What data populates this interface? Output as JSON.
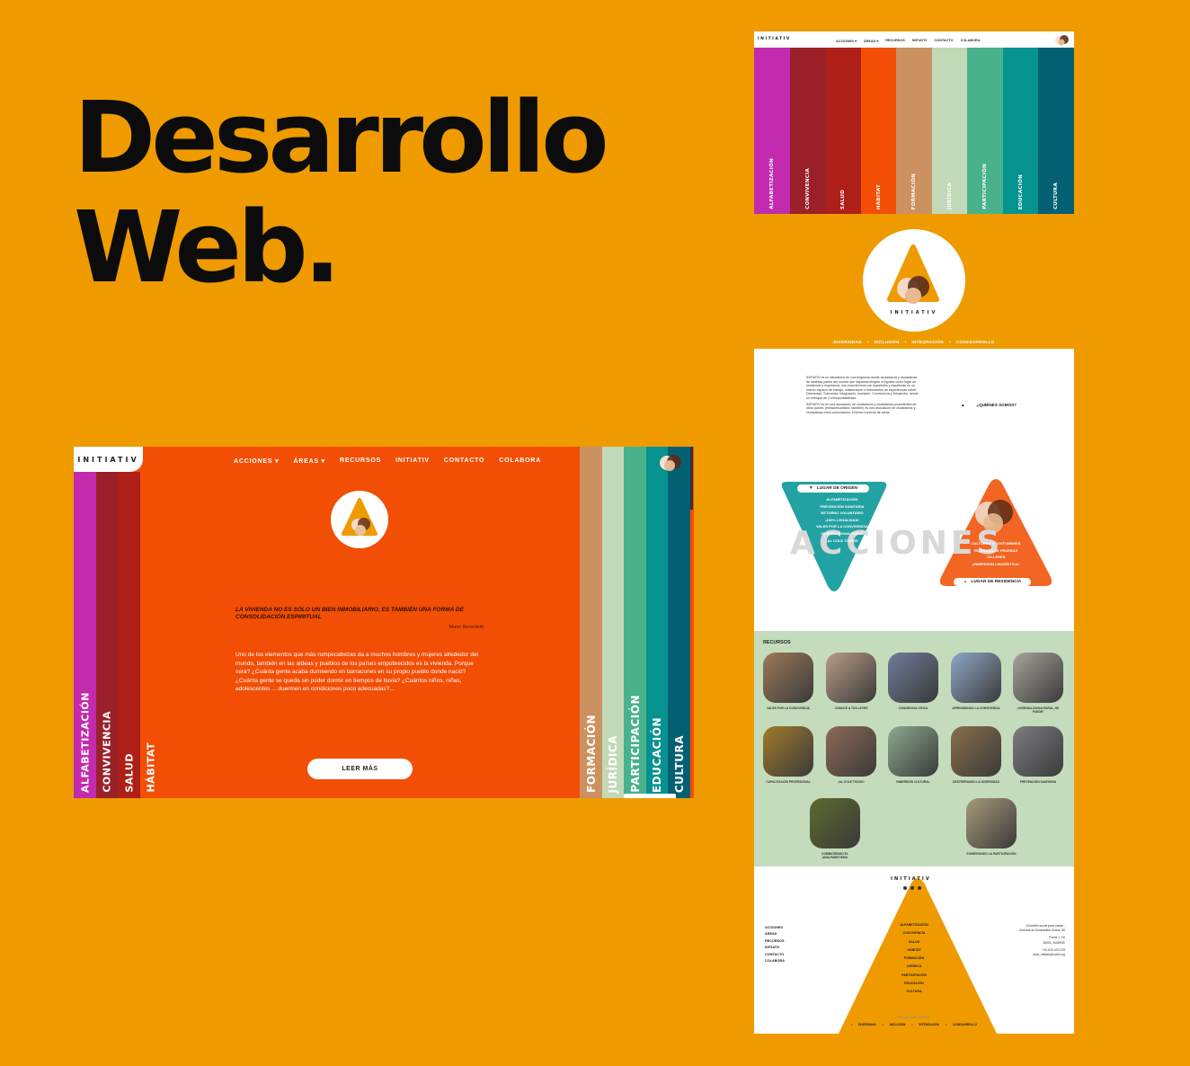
{
  "headline": {
    "line1": "Desarrollo",
    "line2": "Web."
  },
  "brand": {
    "logo": "INITIATIV",
    "accent": "#EF9B00",
    "background": "#EF9B00"
  },
  "area_colors": [
    "#C22BAE",
    "#9A2129",
    "#AD1F17",
    "#F24E05",
    "#CC9160",
    "#C2D9B7",
    "#4AB18D",
    "#06938F",
    "#036073"
  ],
  "desktop": {
    "nav": [
      "ACCIONES ▾",
      "ÁREAS ▾",
      "RECURSOS",
      "INITIATIV",
      "CONTACTO",
      "COLABORA"
    ],
    "left_areas": [
      "ALFABETIZACIÓN",
      "CONVIVENCIA",
      "SALUD",
      "HÁBITAT"
    ],
    "right_areas": [
      "FORMACIÓN",
      "JURÍDICA",
      "PARTICIPACIÓN",
      "EDUCACIÓN",
      "CULTURA"
    ],
    "quote": "LA VIVIENDA NO ES SÓLO UN BIEN INMOBILIARIO, ES TAMBIÉN UNA FORMA DE CONSOLIDACIÓN ESPIRITUAL",
    "author": "Mario Benedetti",
    "paragraph": "Uno de los elementos que más rompecabezas da a muchos hombres y mujeres alrededor del mundo, también en las aldeas y pueblos de los países empobrecidos es la vivienda. Porque sera? ¿Cuánta gente acaba durmiendo en barracones en su propio pueblo donde nació? ¿Cuánta gente se queda sin poder dormir en tiempos de lluvia? ¿Cuántos niños, niñas, adolescentes ... duermen en condiciones poco adecuadas?...",
    "button": "LEER MÁS"
  },
  "top_mock": {
    "nav": [
      "ACCIONES ▾",
      "ÁREAS ▾",
      "RECURSOS",
      "INITIATIV",
      "CONTACTO",
      "COLABORA"
    ],
    "areas": [
      "ALFABETIZACIÓN",
      "CONVIVENCIA",
      "SALUD",
      "HÁBITAT",
      "FORMACIÓN",
      "JURÍDICA",
      "PARTICIPACIÓN",
      "EDUCACIÓN",
      "CULTURA"
    ]
  },
  "long_page": {
    "subnav": [
      "DIVERSIDAD",
      "•",
      "INCLUSIÓN",
      "•",
      "INTEGRACIÓN",
      "•",
      "CODESARROLLO"
    ],
    "intro_1": "INITIATIV es un laboratorio de convergencia donde ciudadanos y ciudadanas de distintas partes del mundo que hayamos elegido a España como lugar de residencia y esperanza, nos encontremos con españoles y españolas en un mismo espacio de trabajo, colaboración e intercambio de esperiencias sobre: Diversidad, Tolerancia, Integración, Inclusión, Convivencia y Desarrollo, desde un enfoque de Corresponsabilidad.",
    "intro_2": "INITIATIV es es una asociación de ciudadanos y ciudadanas procedentes de otros países (extracomunitario, también) es una asociación de ciudadanos y ciudadanas extra comunitarios, el tema recuerdo de venta",
    "quienes": "¿QUIÉNES SOMOS?",
    "acciones_word": "ACCIONES",
    "origen_label": "LUGAR DE ORIGEN",
    "origen_items": [
      "ALFABETIZACIÓN",
      "PREVENCIÓN SANITARIA",
      "RETORNO VOLUNTARIO",
      "¡100% LEGALIDAD!",
      "VALES POR LA CONVIVENCIA",
      "VIVIENDA DIGNA RURAL",
      "¡AL COLE TODOS!"
    ],
    "residencia_items": [
      "CULTURAS Y COSTUMBRES",
      "RECOGIDA DE PRUEBAS",
      "TALLERES",
      "¡INMERSIÓN LINGÜÍSTICA!"
    ],
    "residencia_label": "LUGAR DE RESIDENCIA",
    "recursos_title": "RECURSOS",
    "recursos": [
      {
        "label": "VALES POR LA CONVIVENCIA",
        "color": "#9C7A5A"
      },
      {
        "label": "CONOCE A TUS LEYES",
        "color": "#B89C86"
      },
      {
        "label": "CONCIENCIA CÍVICA",
        "color": "#6F7D9A"
      },
      {
        "label": "APRENDIENDO LA CONVIVENCIA",
        "color": "#8FA7C7"
      },
      {
        "label": "¡VIVIENDA DIGNA RURAL, SE PUEDE!",
        "color": "#A7A39C"
      },
      {
        "label": "CAPACITACIÓN PROFESIONAL",
        "color": "#A07A2A"
      },
      {
        "label": "¡AL COLE TODOS!",
        "color": "#8E6A55"
      },
      {
        "label": "INMERSIÓN CULTURAL",
        "color": "#8CA98F"
      },
      {
        "label": "DESTERRANDO LA DIVERSIDAD",
        "color": "#8A6F4A"
      },
      {
        "label": "PREVENCIÓN SANITARIA",
        "color": "#7E7E82"
      },
      {
        "label": "COMBATIENDO EL ANALFABETISMO",
        "color": "#5E6A2E"
      },
      {
        "label": "FOMENTANDO LA PARTICIPACIÓN",
        "color": "#A89B7A"
      }
    ],
    "footer_menu": [
      "ACCIONES",
      "ÁREAS",
      "RECURSOS",
      "INITIATIV",
      "CONTACTO",
      "COLABORA"
    ],
    "footer_areas": [
      "ALFABETIZACIÓN",
      "CONVIVENCIA",
      "SALUD",
      "HÁBITAT",
      "FORMACIÓN",
      "JURÍDICA",
      "PARTICIPACIÓN",
      "EDUCACIÓN",
      "CULTURA"
    ],
    "footer_info": [
      "Domicilio social para cartas :",
      "Avenida de Smaraldies Grana, 89",
      "",
      "Portal 1, 2A",
      "28001, MADRID",
      "",
      "+34 615 423 378",
      "infos_initiativ@ccitiv.org"
    ],
    "footer_bottom": [
      "PRIVACIDAD",
      "CEIKIES"
    ],
    "footer_bottom2": [
      "•",
      "DIVERSIDAD",
      "•",
      "INCLUSIÓN",
      "•",
      "INTEGRACIÓN",
      "•",
      "CODESARROLLO"
    ]
  }
}
